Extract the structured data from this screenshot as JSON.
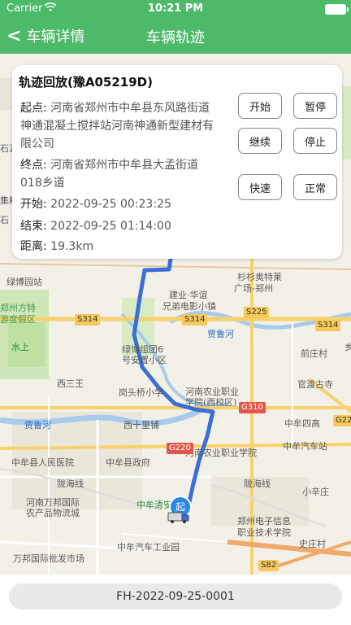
{
  "status_bar": {
    "carrier": "Carrier",
    "time": "10:21 PM"
  },
  "navbar": {
    "back_label": "车辆详情",
    "title": "车辆轨迹"
  },
  "panel": {
    "title": "轨迹回放(豫A05219D)",
    "start_key": "起点:",
    "start_value_lines": [
      "河南省郑州市中牟县东风路街道",
      "神通混凝土搅拌站河南神通新型建材有",
      "限公司"
    ],
    "end_key": "终点:",
    "end_value_lines": [
      "河南省郑州市中牟县大孟街道",
      "018乡道"
    ],
    "begin_key": "开始:",
    "begin_value": "2022-09-25 00:23:25",
    "finish_key": "结束:",
    "finish_value": "2022-09-25 01:14:00",
    "distance_key": "距离:",
    "distance_value": "19.3km",
    "buttons": {
      "start": "开始",
      "pause": "暂停",
      "resume": "继续",
      "stop": "停止",
      "fast": "快速",
      "normal": "正常"
    }
  },
  "map": {
    "start_marker": "起",
    "labels": {
      "lvbo": "绿博园站",
      "shanshan": "杉杉奥特莱",
      "guangchang": "广场-郑州",
      "jianye1": "建业·华谊",
      "jianye2": "兄弟电影小镇",
      "lvbozu1": "绿博组团6",
      "lvbozu2": "号安置小区",
      "xisanwang": "西三王",
      "gangtiao": "岗头桥小学",
      "nongye1": "河南农业职业",
      "nongye2": "学院(西校区)",
      "xishiliou": "西十里铺",
      "qianzhuang": "前庄村",
      "guandu": "官渡古寺",
      "zhongmou4": "中牟四高",
      "zhongmouqiche": "中牟汽车站",
      "renmin": "中牟县人民医院",
      "zhengfu": "中牟县政府",
      "nongyeyuan": "河南农业职业学院",
      "wanbang1": "河南万邦国际",
      "wanbang2": "农产品物流城",
      "wanbang3": "万邦国际批发市场",
      "longhai1": "陇海线",
      "longhai2": "陇海线",
      "jiahe": "贾鲁河",
      "jiahe2": "贾鲁河",
      "dianzi1": "郑州电子信息",
      "dianzi2": "职业技术学院",
      "industrial": "中牟汽车工业园",
      "xiaoxinzhuang": "小辛庄",
      "shiyingcun": "史庄村",
      "zhongmouqing": "中牟清安",
      "zhengzhoufang1": "郑州方特",
      "zhengzhoufang2": "游度假区",
      "shuishang": "水上",
      "shihu": "石湖",
      "jiliang": "集粮",
      "kaiyuan": "乡",
      "shisi": "石"
    },
    "road_badges": {
      "s314a": "S314",
      "s314b": "S314",
      "s314c": "S314",
      "s225": "S225",
      "g310": "G310",
      "g220": "G220",
      "g22": "G22",
      "s82": "S82"
    }
  },
  "footer": {
    "bill_no": "FH-2022-09-25-0001"
  },
  "colors": {
    "brand_green": "#4cba68",
    "track_blue": "#3a6fd8"
  }
}
